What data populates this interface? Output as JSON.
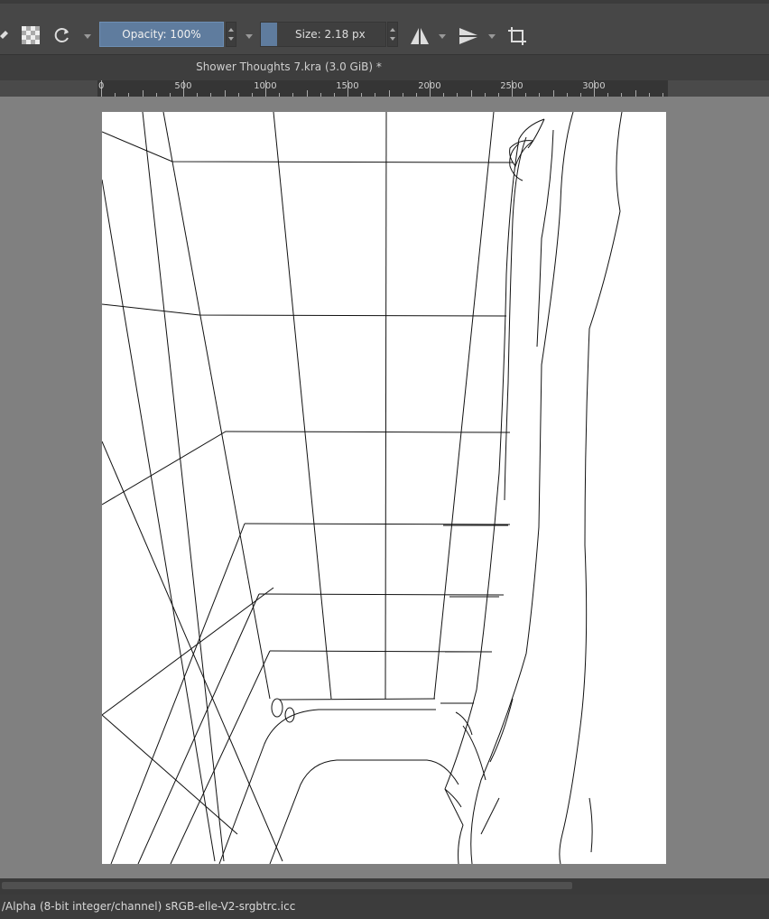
{
  "toolbar": {
    "opacity_label": "Opacity: 100%",
    "size_label": "Size: 2.18 px",
    "accent_color": "#5f7c9e"
  },
  "document": {
    "title": "Shower Thoughts 7.kra (3.0 GiB) *"
  },
  "ruler": {
    "labels": [
      "0",
      "500",
      "1000",
      "1500",
      "2000",
      "2500",
      "3000"
    ]
  },
  "status": {
    "color_space": "/Alpha (8-bit integer/channel)  sRGB-elle-V2-srgbtrc.icc"
  },
  "icons": [
    "eraser-icon",
    "alpha-lock-icon",
    "reset-icon",
    "mirror-horizontal-icon",
    "mirror-vertical-icon",
    "wrap-around-icon"
  ]
}
